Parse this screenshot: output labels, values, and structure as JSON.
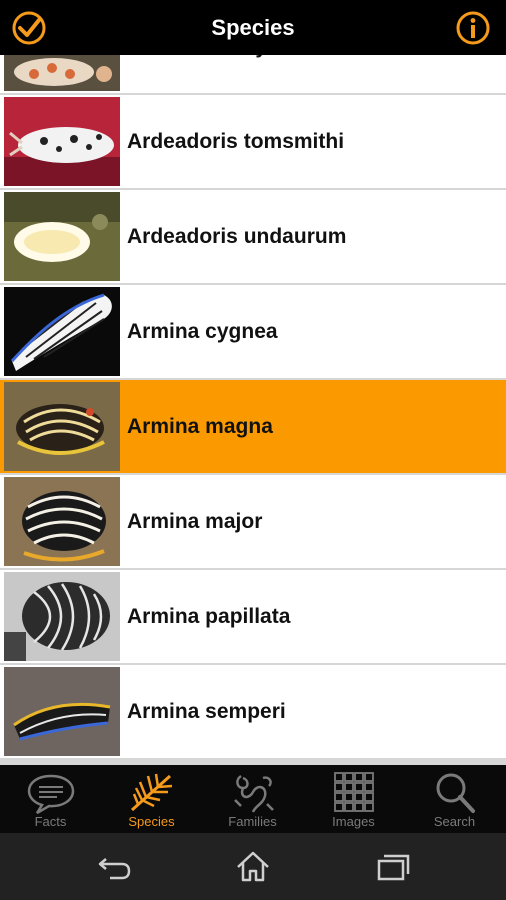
{
  "header": {
    "title": "Species"
  },
  "species_list": [
    {
      "name": "Ardeadoris symmetrica",
      "selected": false
    },
    {
      "name": "Ardeadoris tomsmithi",
      "selected": false
    },
    {
      "name": "Ardeadoris undaurum",
      "selected": false
    },
    {
      "name": "Armina cygnea",
      "selected": false
    },
    {
      "name": "Armina magna",
      "selected": true
    },
    {
      "name": "Armina major",
      "selected": false
    },
    {
      "name": "Armina papillata",
      "selected": false
    },
    {
      "name": "Armina semperi",
      "selected": false
    }
  ],
  "tabs": [
    {
      "label": "Facts",
      "icon": "speech-bubble-icon",
      "active": false
    },
    {
      "label": "Species",
      "icon": "feather-icon",
      "active": true
    },
    {
      "label": "Families",
      "icon": "families-icon",
      "active": false
    },
    {
      "label": "Images",
      "icon": "grid-icon",
      "active": false
    },
    {
      "label": "Search",
      "icon": "search-icon",
      "active": false
    }
  ],
  "colors": {
    "accent": "#f59a1b",
    "selected_row": "#fa9a00",
    "bar_background": "#000000"
  }
}
